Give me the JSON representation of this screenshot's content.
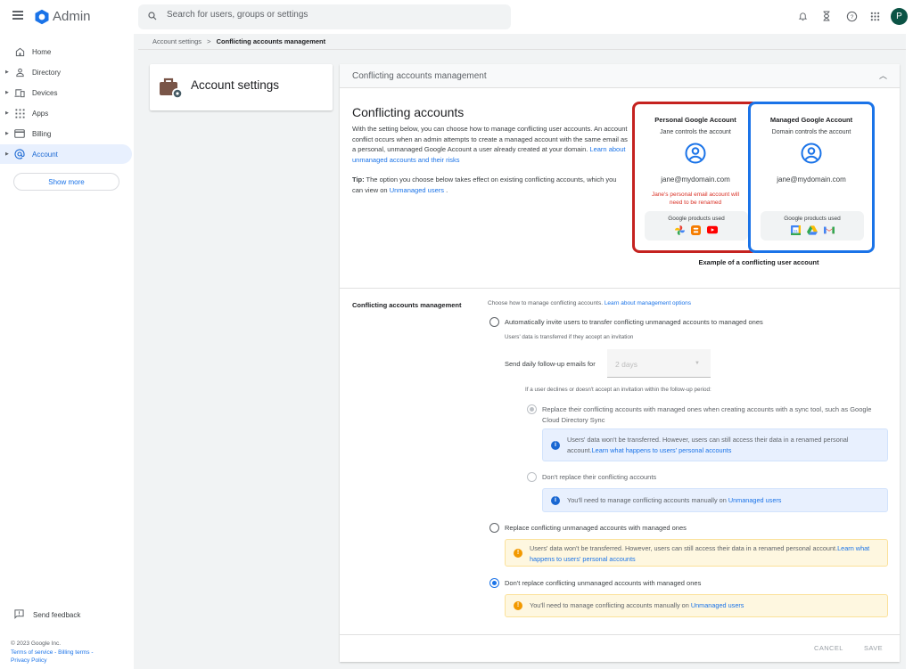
{
  "app": {
    "title": "Admin",
    "search_placeholder": "Search for users, groups or settings",
    "avatar_letter": "P"
  },
  "topbar_icons": [
    "notifications-icon",
    "tasks-hourglass-icon",
    "help-icon",
    "apps-grid-icon"
  ],
  "sidebar": {
    "items": [
      {
        "label": "Home",
        "icon": "home-icon",
        "expandable": false
      },
      {
        "label": "Directory",
        "icon": "person-icon",
        "expandable": true
      },
      {
        "label": "Devices",
        "icon": "devices-icon",
        "expandable": true
      },
      {
        "label": "Apps",
        "icon": "apps-icon",
        "expandable": true
      },
      {
        "label": "Billing",
        "icon": "credit-card-icon",
        "expandable": true
      },
      {
        "label": "Account",
        "icon": "at-sign-icon",
        "expandable": true,
        "active": true
      }
    ],
    "show_more": "Show more",
    "feedback": "Send feedback",
    "footer": {
      "copyright": "© 2023 Google Inc.",
      "terms": "Terms of service",
      "billing_terms": "Billing terms",
      "privacy": "Privacy Policy",
      "sep": " - "
    }
  },
  "breadcrumb": {
    "parent": "Account settings",
    "sep": ">",
    "current": "Conflicting accounts management"
  },
  "account_card": {
    "title": "Account settings"
  },
  "panel": {
    "header": "Conflicting accounts management",
    "heading": "Conflicting accounts",
    "intro": "With the setting below, you can choose how to manage conflicting user accounts. An account conflict occurs when an admin attempts to create a managed account with the same email as a personal, unmanaged Google Account a user already created at your domain. ",
    "intro_link": "Learn about unmanaged accounts and their risks",
    "tip_label": "Tip:",
    "tip_text": " The option you choose below takes effect on existing conflicting accounts, which you can view on ",
    "tip_link": "Unmanaged users",
    "tip_end": " .",
    "illustration": {
      "personal": {
        "title": "Personal Google Account",
        "subtitle": "Jane controls the account",
        "email": "jane@mydomain.com",
        "warning": "Jane's personal email account will need to be renamed",
        "products_label": "Google products used",
        "products": [
          "Google Photos",
          "Blogger",
          "YouTube"
        ],
        "border_color": "#c5221f"
      },
      "managed": {
        "title": "Managed Google Account",
        "subtitle": "Domain controls the account",
        "email": "jane@mydomain.com",
        "products_label": "Google products used",
        "products": [
          "Google Calendar",
          "Google Drive",
          "Gmail"
        ],
        "border_color": "#1a73e8"
      },
      "caption": "Example of a conflicting user account"
    },
    "setting": {
      "label": "Conflicting accounts management",
      "description": "Choose how to manage conflicting accounts. ",
      "description_link": "Learn about management options",
      "options": [
        {
          "label": "Automatically invite users to transfer conflicting unmanaged accounts to managed ones",
          "selected": false,
          "helper": "Users' data is transferred if they accept an invitation"
        },
        {
          "label": "Replace conflicting unmanaged accounts with managed ones",
          "selected": false
        },
        {
          "label": "Don't replace conflicting unmanaged accounts with managed ones",
          "selected": true
        }
      ],
      "followup_label": "Send daily follow-up emails for",
      "followup_value": "2 days",
      "decline_text": "If a user declines or doesn't accept an invitation within the follow-up period:",
      "sub_options": [
        {
          "label": "Replace their conflicting accounts with managed ones when creating accounts with a sync tool, such as Google Cloud Directory Sync",
          "selected": true,
          "disabled": true
        },
        {
          "label": "Don't replace their conflicting accounts",
          "selected": false,
          "disabled": true
        }
      ],
      "notes": {
        "not_transferred": "Users' data won't be transferred. However, users can still access their data in a renamed personal account.",
        "not_transferred_link": "Learn what happens to users' personal accounts",
        "manual": "You'll need to manage conflicting accounts manually on ",
        "manual_link": "Unmanaged users"
      }
    },
    "buttons": {
      "cancel": "CANCEL",
      "save": "SAVE"
    }
  }
}
